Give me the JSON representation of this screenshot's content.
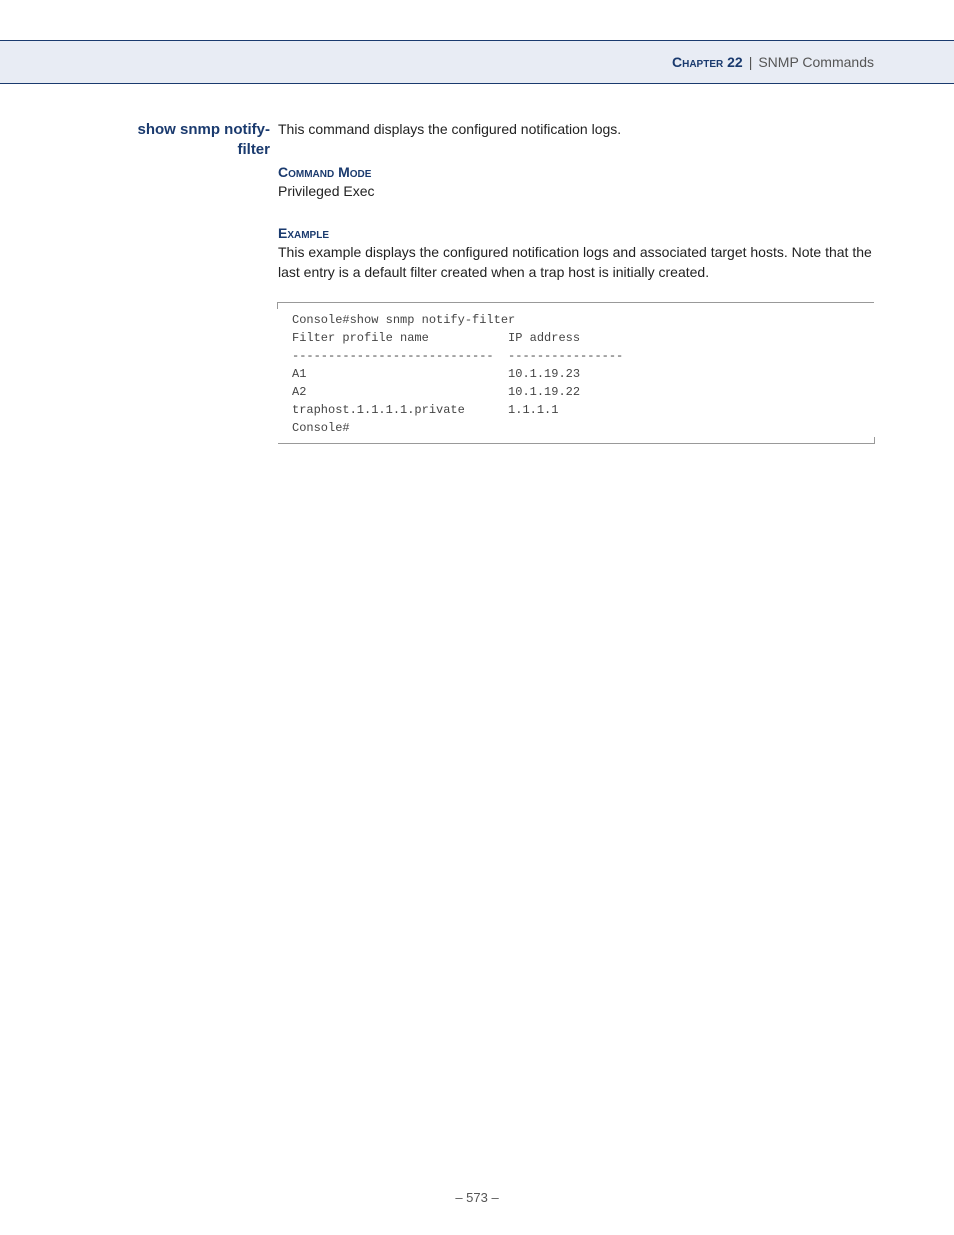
{
  "header": {
    "chapter": "Chapter 22",
    "divider": "|",
    "title": "SNMP Commands"
  },
  "command": {
    "name_line1": "show snmp notify-",
    "name_line2": "filter",
    "description": "This command displays the configured notification logs."
  },
  "sections": {
    "mode_heading": "Command Mode",
    "mode_text": "Privileged Exec",
    "example_heading": "Example",
    "example_text": "This example displays the configured notification logs and associated target hosts. Note that the last entry is a default filter created when a trap host is initially created."
  },
  "code": "Console#show snmp notify-filter\nFilter profile name           IP address\n----------------------------  ----------------\nA1                            10.1.19.23\nA2                            10.1.19.22\ntraphost.1.1.1.1.private      1.1.1.1\nConsole#",
  "page_number": "– 573 –"
}
